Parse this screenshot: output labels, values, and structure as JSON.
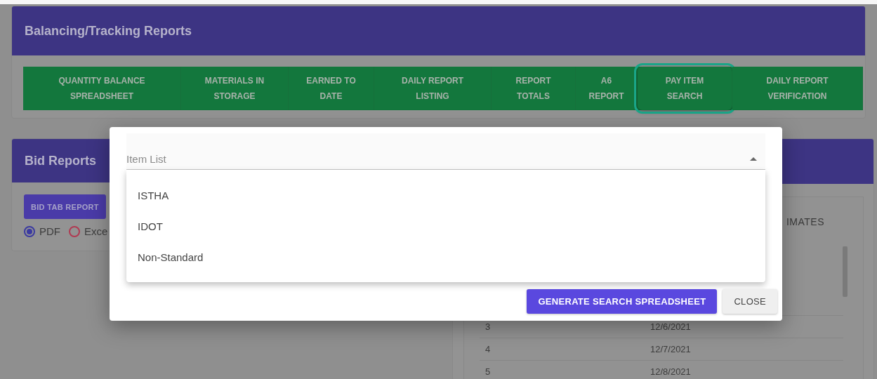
{
  "balancing_card": {
    "title": "Balancing/Tracking Reports",
    "buttons": [
      {
        "label": "QUANTITY BALANCE\nSPREADSHEET",
        "selected": false
      },
      {
        "label": "MATERIALS IN\nSTORAGE",
        "selected": false
      },
      {
        "label": "EARNED TO\nDATE",
        "selected": false
      },
      {
        "label": "DAILY REPORT\nLISTING",
        "selected": false
      },
      {
        "label": "REPORT\nTOTALS",
        "selected": false
      },
      {
        "label": "A6\nREPORT",
        "selected": false
      },
      {
        "label": "PAY ITEM\nSEARCH",
        "selected": true
      },
      {
        "label": "DAILY REPORT\nVERIFICATION",
        "selected": false
      }
    ]
  },
  "bid_card": {
    "title": "Bid Reports",
    "button": "BID TAB REPORT",
    "formats": [
      {
        "label": "PDF",
        "selected": true
      },
      {
        "label": "Exce",
        "selected": false
      }
    ]
  },
  "estimates_card": {
    "tab": "IMATES",
    "rows": [
      {
        "column_1": "3",
        "column_2": "12/6/2021"
      },
      {
        "column_1": "4",
        "column_2": "12/7/2021"
      },
      {
        "column_1": "5",
        "column_2": "12/8/2021"
      }
    ]
  },
  "dialog": {
    "select": {
      "label": "Item List",
      "expanded": true
    },
    "options": [
      "ISTHA",
      "IDOT",
      "Non-Standard"
    ],
    "buttons": [
      {
        "kind": "primary",
        "label": "GENERATE SEARCH SPREADSHEET"
      },
      {
        "kind": "secondary",
        "label": "CLOSE"
      }
    ]
  }
}
